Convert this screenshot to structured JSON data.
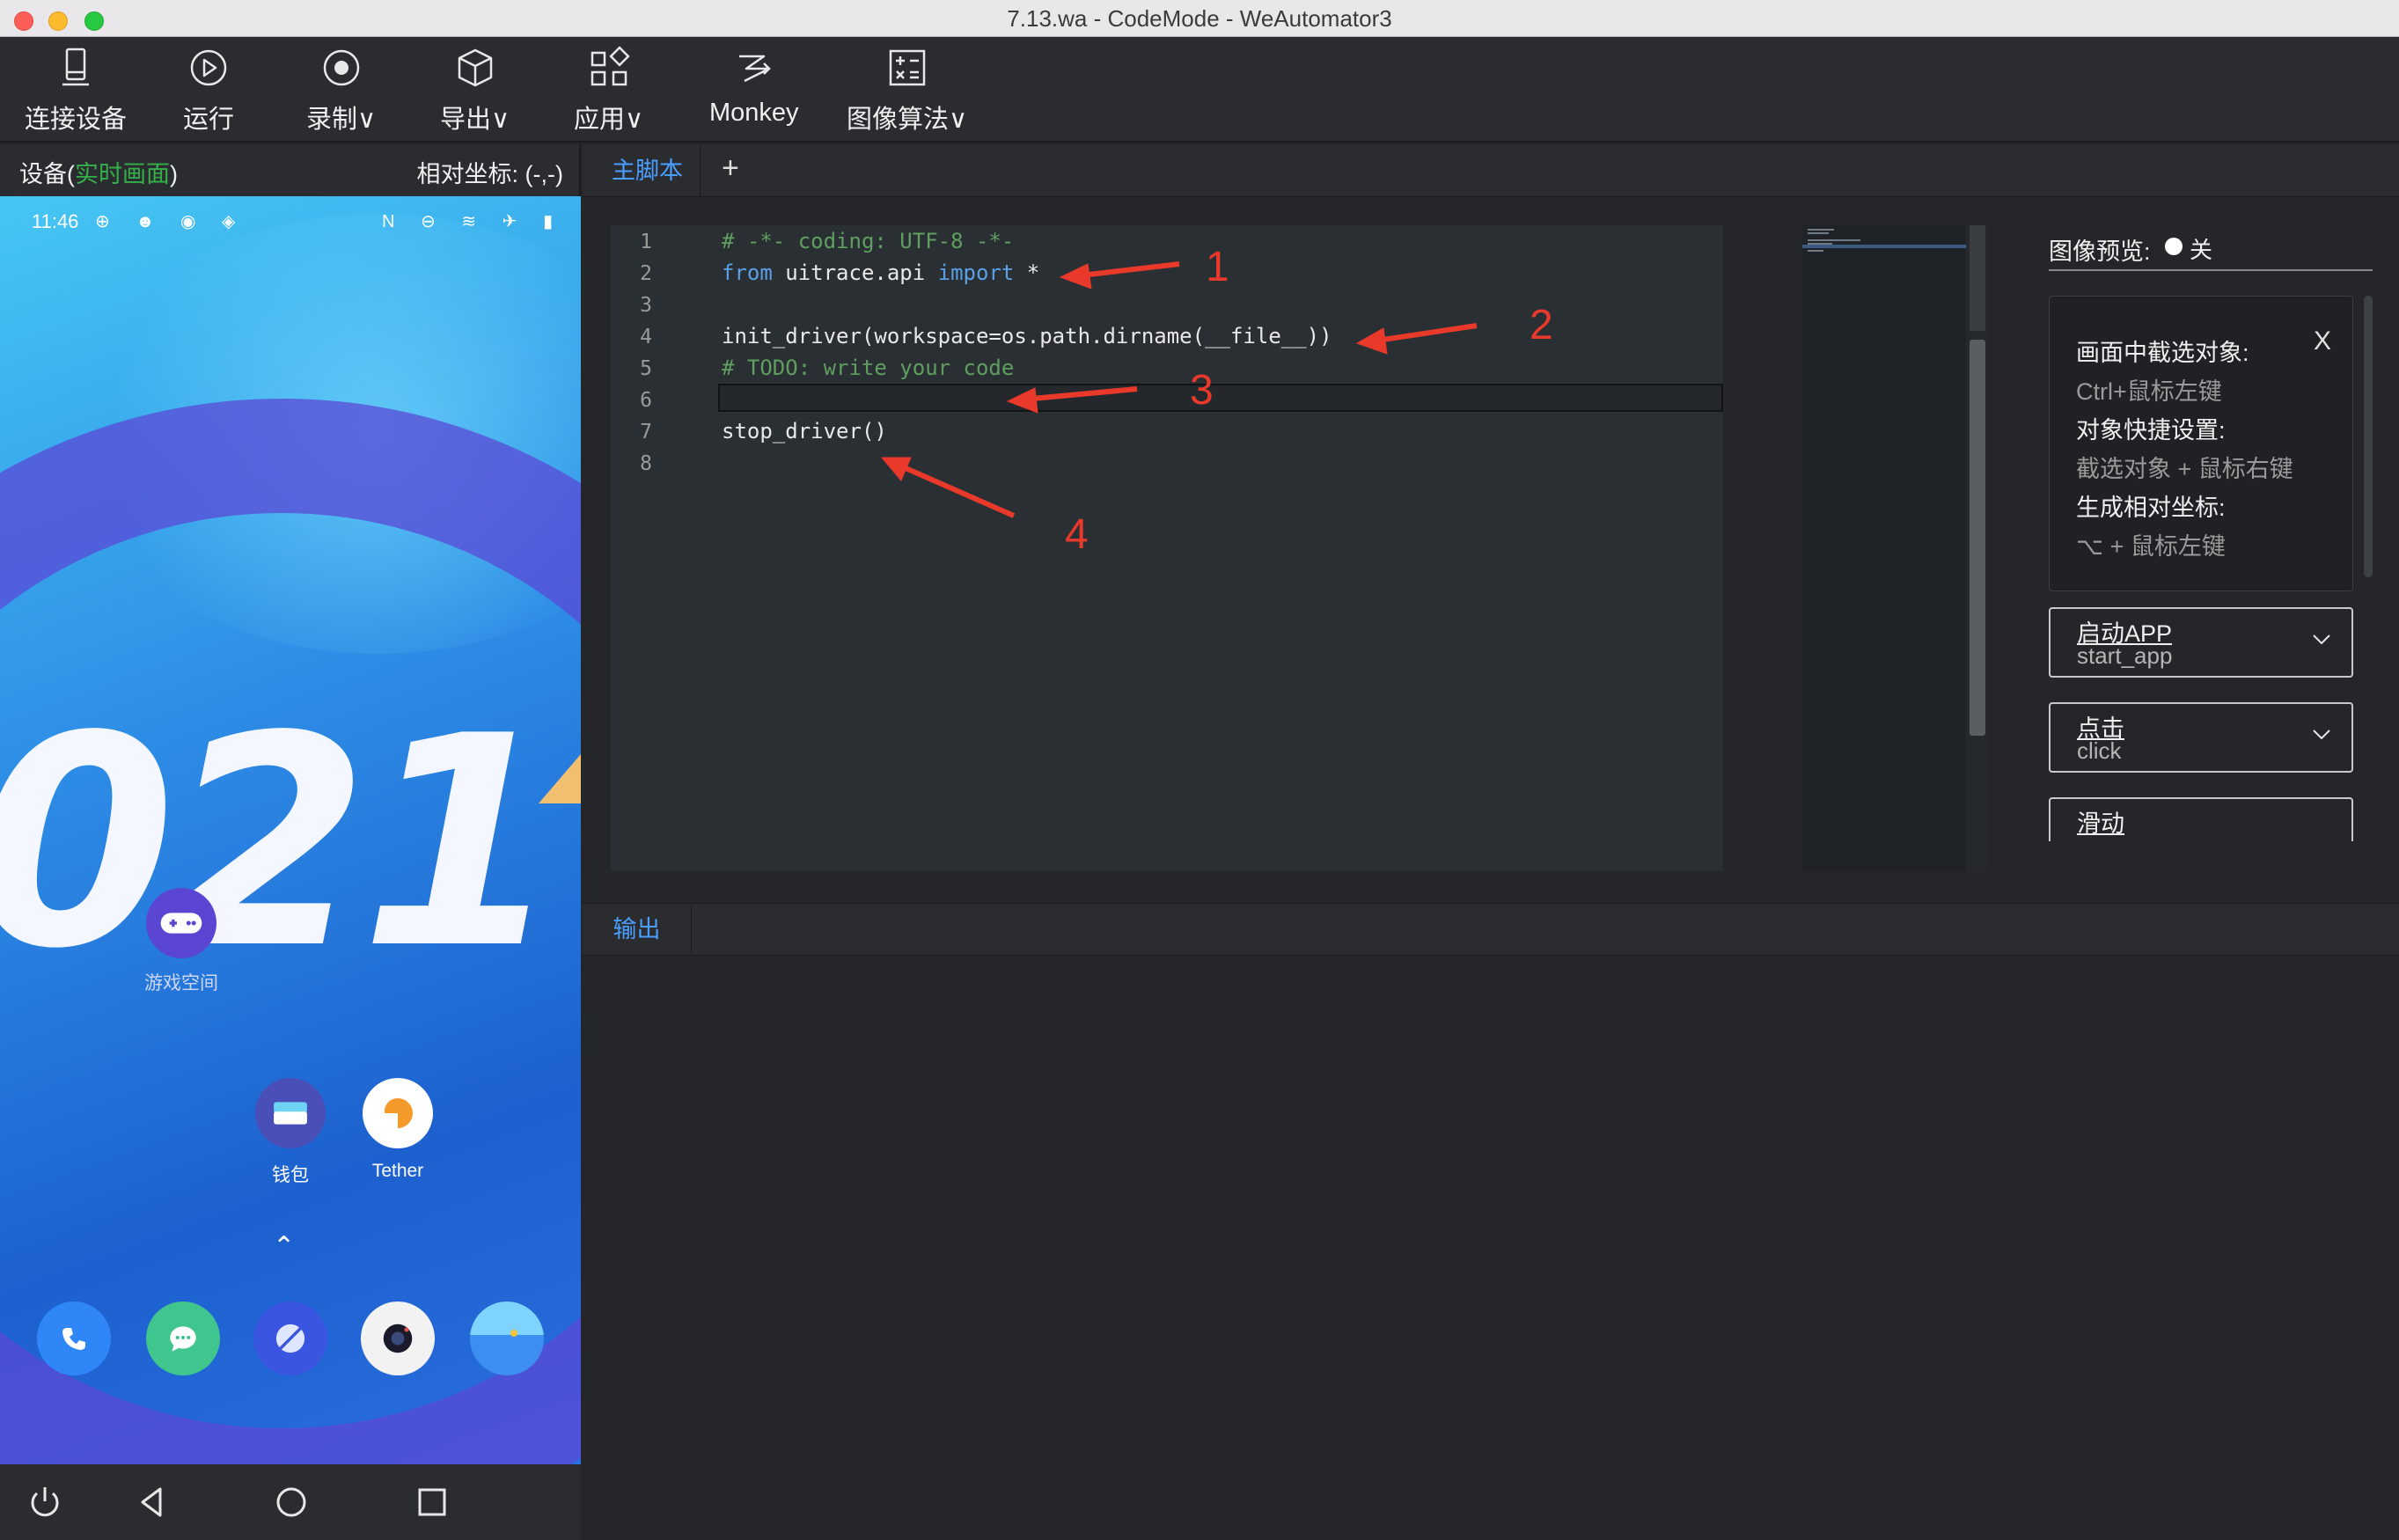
{
  "window": {
    "title": "7.13.wa - CodeMode - WeAutomator3"
  },
  "toolbar": {
    "connect": "连接设备",
    "run": "运行",
    "record": "录制∨",
    "export": "导出∨",
    "apps": "应用∨",
    "monkey": "Monkey",
    "image_algo": "图像算法∨"
  },
  "device": {
    "title_prefix": "设备(",
    "title_live": "实时画面",
    "title_suffix": ")",
    "coords": "相对坐标: (-,-)"
  },
  "phone": {
    "time": "11:46",
    "status_icons": "⊕ ☻ ◉ ◈",
    "status_right": "N ⊖ ≋ ✈ ▮",
    "big_number": "021",
    "game_label": "游戏空间",
    "wallet_label": "钱包",
    "tether_label": "Tether",
    "up_arrow": "⌃"
  },
  "tabs": {
    "main": "主脚本",
    "add": "+"
  },
  "editor": {
    "line_numbers": [
      "1",
      "2",
      "3",
      "4",
      "5",
      "6",
      "7",
      "8"
    ],
    "line1": "# -*- coding: UTF-8 -*-",
    "line2_kw1": "from",
    "line2_mid": " uitrace.api ",
    "line2_kw2": "import",
    "line2_end": " *",
    "line4": "init_driver(workspace=os.path.dirname(__file__))",
    "line5": "# TODO: write your code",
    "line7": "stop_driver()"
  },
  "annotations": [
    "1",
    "2",
    "3",
    "4"
  ],
  "side": {
    "preview_label": "图像预览:",
    "preview_state": "关",
    "tip1_title": "画面中截选对象:",
    "tip1_desc": "Ctrl+鼠标左键",
    "tip2_title": "对象快捷设置:",
    "tip2_desc": "截选对象 + 鼠标右键",
    "tip3_title": "生成相对坐标:",
    "tip3_desc": "⌥ + 鼠标左键",
    "close": "X",
    "functions": [
      {
        "zh": "启动APP",
        "en": "start_app"
      },
      {
        "zh": "点击",
        "en": "click"
      },
      {
        "zh": "滑动",
        "en": ""
      }
    ]
  },
  "output": {
    "tab": "输出"
  },
  "colors": {
    "accent": "#4a9eff",
    "live_green": "#34b04a",
    "annotation_red": "#e8392a"
  }
}
